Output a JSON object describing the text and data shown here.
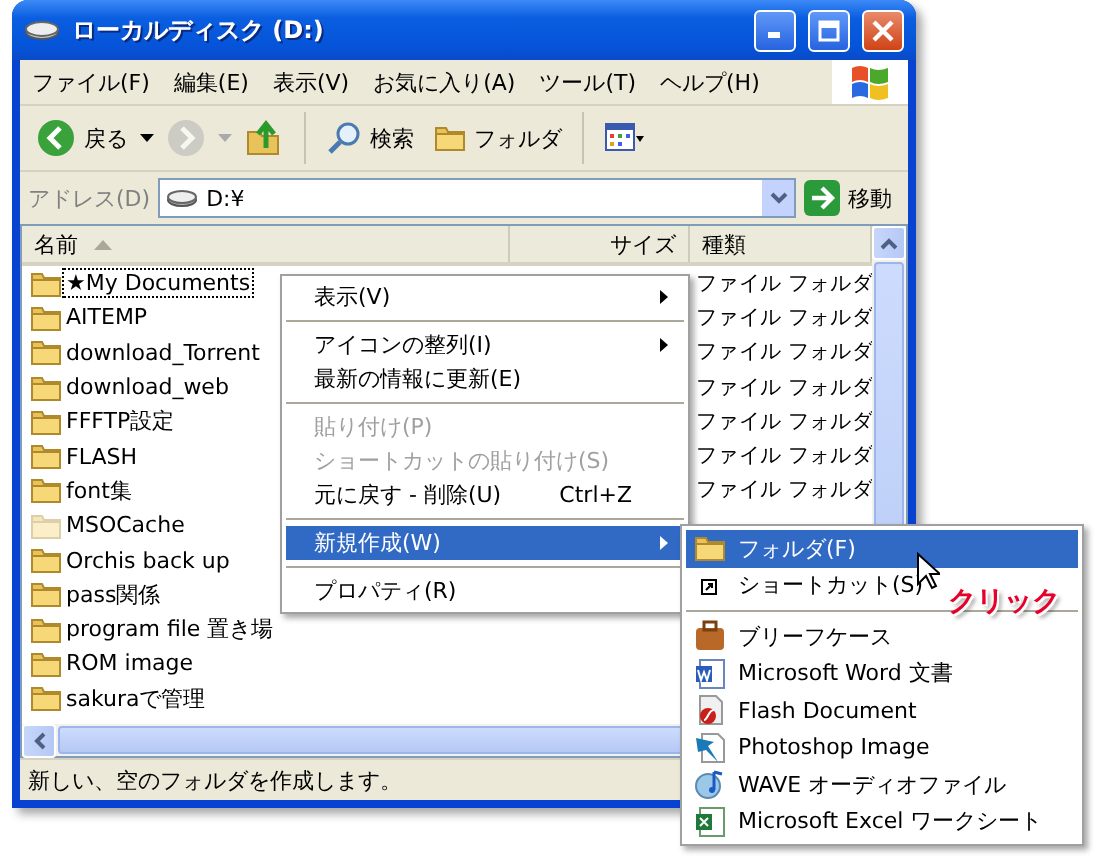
{
  "window": {
    "title": "ローカルディスク (D:)"
  },
  "menu_bar": [
    "ファイル(F)",
    "編集(E)",
    "表示(V)",
    "お気に入り(A)",
    "ツール(T)",
    "ヘルプ(H)"
  ],
  "toolbar": [
    {
      "kind": "back",
      "label": "戻る",
      "disabled": false
    },
    {
      "kind": "forward",
      "disabled": true
    },
    {
      "kind": "up",
      "disabled": false
    },
    {
      "kind": "search",
      "label": "検索",
      "disabled": false
    },
    {
      "kind": "folders",
      "label": "フォルダ",
      "disabled": false
    },
    {
      "kind": "views",
      "disabled": false
    }
  ],
  "address_bar": {
    "label": "アドレス(D)",
    "value": "D:¥",
    "go": "移動"
  },
  "file_list": {
    "columns": [
      "名前",
      "サイズ",
      "種類"
    ],
    "rows": [
      {
        "name": "★My Documents",
        "type": "ファイル フォルダ",
        "focused": true,
        "hidden": false
      },
      {
        "name": "AITEMP",
        "type": "ファイル フォルダ",
        "focused": false,
        "hidden": false
      },
      {
        "name": "download_Torrent",
        "type": "ファイル フォルダ",
        "focused": false,
        "hidden": false
      },
      {
        "name": "download_web",
        "type": "ファイル フォルダ",
        "focused": false,
        "hidden": false
      },
      {
        "name": "FFFTP設定",
        "type": "ファイル フォルダ",
        "focused": false,
        "hidden": false
      },
      {
        "name": "FLASH",
        "type": "ファイル フォルダ",
        "focused": false,
        "hidden": false
      },
      {
        "name": "font集",
        "type": "ファイル フォルダ",
        "focused": false,
        "hidden": false
      },
      {
        "name": "MSOCache",
        "focused": false,
        "hidden": true
      },
      {
        "name": "Orchis back up",
        "focused": false,
        "hidden": false
      },
      {
        "name": "pass関係",
        "focused": false,
        "hidden": false
      },
      {
        "name": "program file 置き場",
        "focused": false,
        "hidden": false
      },
      {
        "name": "ROM image",
        "focused": false,
        "hidden": false
      },
      {
        "name": "sakuraで管理",
        "focused": false,
        "hidden": false
      }
    ]
  },
  "context_menu": [
    {
      "kind": "item",
      "label": "表示(V)",
      "submenu": true,
      "disabled": false,
      "selected": false
    },
    {
      "kind": "separator"
    },
    {
      "kind": "item",
      "label": "アイコンの整列(I)",
      "submenu": true,
      "disabled": false,
      "selected": false
    },
    {
      "kind": "item",
      "label": "最新の情報に更新(E)",
      "submenu": false,
      "disabled": false,
      "selected": false
    },
    {
      "kind": "separator"
    },
    {
      "kind": "item",
      "label": "貼り付け(P)",
      "submenu": false,
      "disabled": true,
      "selected": false
    },
    {
      "kind": "item",
      "label": "ショートカットの貼り付け(S)",
      "submenu": false,
      "disabled": true,
      "selected": false
    },
    {
      "kind": "item",
      "label": "元に戻す - 削除(U)",
      "shortcut": "Ctrl+Z",
      "submenu": false,
      "disabled": false,
      "selected": false
    },
    {
      "kind": "separator"
    },
    {
      "kind": "item",
      "label": "新規作成(W)",
      "submenu": true,
      "disabled": false,
      "selected": true
    },
    {
      "kind": "separator"
    },
    {
      "kind": "item",
      "label": "プロパティ(R)",
      "submenu": false,
      "disabled": false,
      "selected": false
    }
  ],
  "new_submenu": [
    {
      "kind": "item",
      "label": "フォルダ(F)",
      "selected": true
    },
    {
      "kind": "item",
      "label": "ショートカット(S)",
      "selected": false
    },
    {
      "kind": "separator"
    },
    {
      "kind": "item",
      "label": "ブリーフケース",
      "selected": false
    },
    {
      "kind": "item",
      "label": "Microsoft Word 文書",
      "selected": false
    },
    {
      "kind": "item",
      "label": "Flash Document",
      "selected": false
    },
    {
      "kind": "item",
      "label": "Photoshop Image",
      "selected": false
    },
    {
      "kind": "item",
      "label": "WAVE オーディオファイル",
      "selected": false
    },
    {
      "kind": "item",
      "label": "Microsoft Excel ワークシート",
      "selected": false
    }
  ],
  "annotation": "クリック",
  "status_bar": "新しい、空のフォルダを作成します。"
}
